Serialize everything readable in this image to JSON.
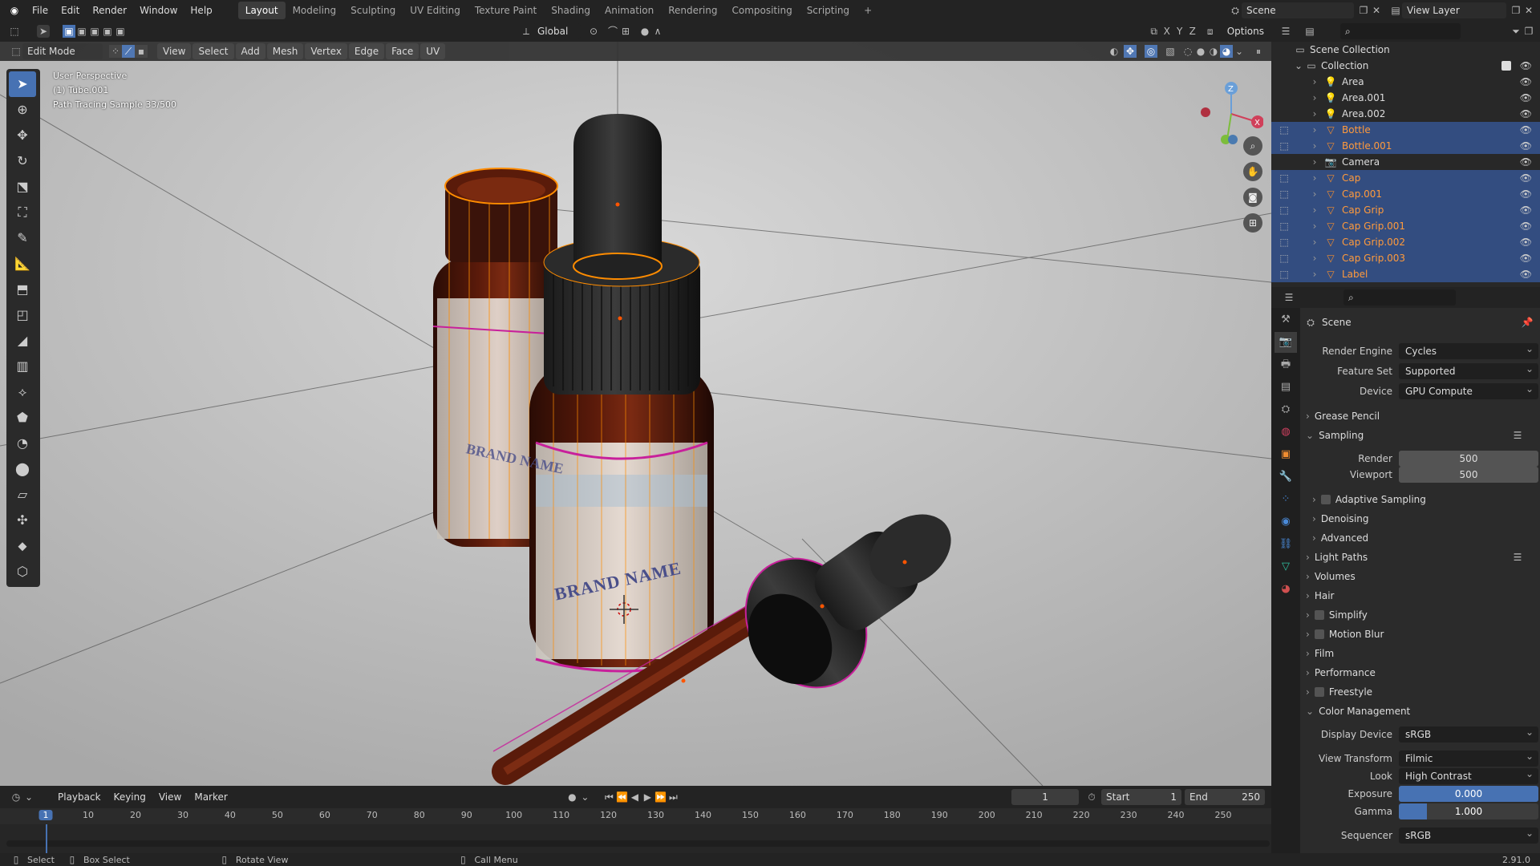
{
  "topbar": {
    "menus": [
      "File",
      "Edit",
      "Render",
      "Window",
      "Help"
    ],
    "workspaces": [
      "Layout",
      "Modeling",
      "Sculpting",
      "UV Editing",
      "Texture Paint",
      "Shading",
      "Animation",
      "Rendering",
      "Compositing",
      "Scripting"
    ],
    "active_workspace": "Layout",
    "scene": "Scene",
    "view_layer": "View Layer"
  },
  "viewport_header": {
    "mode": "Edit Mode",
    "menus": [
      "View",
      "Select",
      "Add",
      "Mesh",
      "Vertex",
      "Edge",
      "Face",
      "UV"
    ],
    "orientation": "Global",
    "axes": [
      "X",
      "Y",
      "Z"
    ],
    "options": "Options"
  },
  "overlay_text": {
    "line1": "User Perspective",
    "line2": "(1) Tube.001",
    "line3": "Path Tracing Sample 33/500"
  },
  "label_text": "BRAND NAME",
  "outliner": {
    "root": "Scene Collection",
    "collection": "Collection",
    "items": [
      {
        "name": "Area",
        "selected": false,
        "icon": "light-icon"
      },
      {
        "name": "Area.001",
        "selected": false,
        "icon": "light-icon"
      },
      {
        "name": "Area.002",
        "selected": false,
        "icon": "light-icon"
      },
      {
        "name": "Bottle",
        "selected": true,
        "icon": "mesh-icon"
      },
      {
        "name": "Bottle.001",
        "selected": true,
        "icon": "mesh-icon"
      },
      {
        "name": "Camera",
        "selected": false,
        "icon": "camera-icon"
      },
      {
        "name": "Cap",
        "selected": true,
        "icon": "mesh-icon"
      },
      {
        "name": "Cap.001",
        "selected": true,
        "icon": "mesh-icon"
      },
      {
        "name": "Cap Grip",
        "selected": true,
        "icon": "mesh-icon"
      },
      {
        "name": "Cap Grip.001",
        "selected": true,
        "icon": "mesh-icon"
      },
      {
        "name": "Cap Grip.002",
        "selected": true,
        "icon": "mesh-icon"
      },
      {
        "name": "Cap Grip.003",
        "selected": true,
        "icon": "mesh-icon"
      },
      {
        "name": "Label",
        "selected": true,
        "icon": "mesh-icon"
      }
    ]
  },
  "properties": {
    "context": "Scene",
    "render_engine_label": "Render Engine",
    "render_engine": "Cycles",
    "feature_set_label": "Feature Set",
    "feature_set": "Supported",
    "device_label": "Device",
    "device": "GPU Compute",
    "panels": [
      "Grease Pencil",
      "Sampling",
      "Light Paths",
      "Volumes",
      "Hair",
      "Simplify",
      "Motion Blur",
      "Film",
      "Performance",
      "Freestyle",
      "Color Management"
    ],
    "sampling": {
      "render_label": "Render",
      "render": "500",
      "viewport_label": "Viewport",
      "viewport": "500",
      "adaptive": "Adaptive Sampling",
      "denoising": "Denoising",
      "advanced": "Advanced"
    },
    "color_management": {
      "display_device_label": "Display Device",
      "display_device": "sRGB",
      "view_transform_label": "View Transform",
      "view_transform": "Filmic",
      "look_label": "Look",
      "look": "High Contrast",
      "exposure_label": "Exposure",
      "exposure": "0.000",
      "gamma_label": "Gamma",
      "gamma": "1.000",
      "sequencer_label": "Sequencer",
      "sequencer": "sRGB"
    }
  },
  "timeline": {
    "menus": [
      "Playback",
      "Keying",
      "View",
      "Marker"
    ],
    "current_frame": "1",
    "start_label": "Start",
    "start": "1",
    "end_label": "End",
    "end": "250",
    "ticks": [
      "1",
      "10",
      "20",
      "30",
      "40",
      "50",
      "60",
      "70",
      "80",
      "90",
      "100",
      "110",
      "120",
      "130",
      "140",
      "150",
      "160",
      "170",
      "180",
      "190",
      "200",
      "210",
      "220",
      "230",
      "240",
      "250"
    ]
  },
  "statusbar": {
    "select": "Select",
    "box_select": "Box Select",
    "rotate": "Rotate View",
    "call_menu": "Call Menu",
    "version": "2.91.0"
  },
  "colors": {
    "accent": "#4772b3",
    "selected_row": "#334d80",
    "selected_text": "#ff9a3c",
    "edge_select": "#ff8c00",
    "seam": "#c8209b"
  }
}
